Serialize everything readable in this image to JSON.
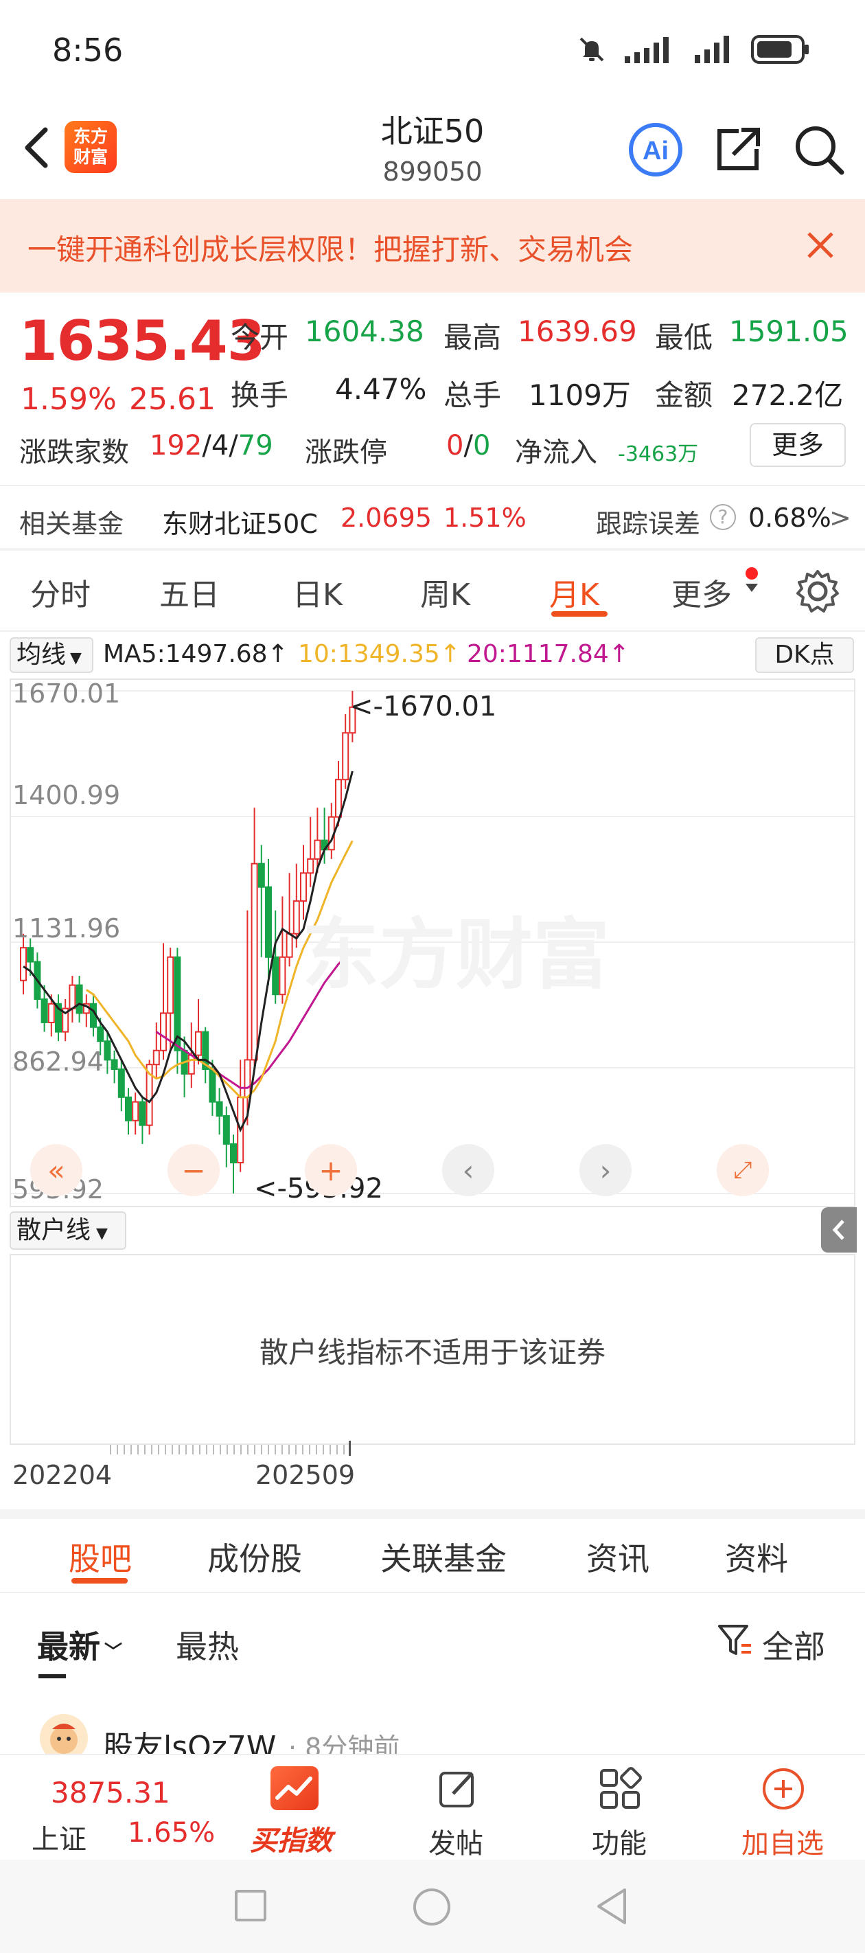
{
  "status": {
    "time": "8:56"
  },
  "header": {
    "title": "北证50",
    "code": "899050",
    "logo_text": "东方财富",
    "ai_label": "Ai"
  },
  "banner": {
    "text": "一键开通科创成长层权限！把握打新、交易机会"
  },
  "quote": {
    "price": "1635.43",
    "change_pct": "1.59%",
    "change_amt": "25.61",
    "open_label": "今开",
    "open": "1604.38",
    "high_label": "最高",
    "high": "1639.69",
    "low_label": "最低",
    "low": "1591.05",
    "turnover_label": "换手",
    "turnover": "4.47%",
    "volume_label": "总手",
    "volume": "1109万",
    "amount_label": "金额",
    "amount": "272.2亿",
    "breadth_label": "涨跌家数",
    "breadth_up": "192",
    "breadth_sep1": "/",
    "breadth_flat": "4",
    "breadth_sep2": "/",
    "breadth_down": "79",
    "limit_label": "涨跌停",
    "limit_up": "0",
    "limit_sep": "/",
    "limit_down": "0",
    "netflow_label": "净流入",
    "netflow": "-3463万",
    "more_label": "更多"
  },
  "fund": {
    "label": "相关基金",
    "name": "东财北证50C",
    "price": "2.0695",
    "change": "1.51%",
    "error_label": "跟踪误差",
    "error": "0.68%",
    "arrow": ">"
  },
  "kline_tabs": [
    "分时",
    "五日",
    "日K",
    "周K",
    "月K",
    "更多"
  ],
  "active_kline_tab": "月K",
  "ma": {
    "selector": "均线",
    "ma5": "MA5:1497.68↑",
    "ma10": "10:1349.35↑",
    "ma20": "20:1117.84↑",
    "dk_label": "DK点",
    "colors": {
      "ma5": "#222222",
      "ma10": "#f0b429",
      "ma20": "#c2188f"
    }
  },
  "chart_data": {
    "type": "candlestick",
    "ylim": [
      593.92,
      1670.01
    ],
    "y_ticks": [
      "1670.01",
      "1400.99",
      "1131.96",
      "862.94",
      "593.92"
    ],
    "max_label": "<-1670.01",
    "min_label": "<-593.92",
    "x_labels": [
      "202204",
      "202509"
    ],
    "watermark": "东方财富",
    "candles": [
      [
        1050,
        1120,
        1020,
        1150
      ],
      [
        1120,
        1090,
        1060,
        1140
      ],
      [
        1090,
        1010,
        990,
        1110
      ],
      [
        1010,
        960,
        940,
        1040
      ],
      [
        960,
        1000,
        930,
        1020
      ],
      [
        1000,
        940,
        920,
        1020
      ],
      [
        940,
        990,
        920,
        1010
      ],
      [
        990,
        1040,
        960,
        1060
      ],
      [
        1040,
        980,
        960,
        1060
      ],
      [
        980,
        1000,
        950,
        1020
      ],
      [
        1000,
        950,
        930,
        1020
      ],
      [
        950,
        920,
        890,
        970
      ],
      [
        920,
        880,
        850,
        940
      ],
      [
        880,
        860,
        830,
        900
      ],
      [
        860,
        800,
        770,
        880
      ],
      [
        800,
        750,
        720,
        820
      ],
      [
        750,
        790,
        720,
        810
      ],
      [
        790,
        740,
        700,
        800
      ],
      [
        740,
        870,
        720,
        880
      ],
      [
        870,
        900,
        840,
        960
      ],
      [
        900,
        980,
        880,
        1130
      ],
      [
        980,
        1100,
        900,
        1120
      ],
      [
        1100,
        900,
        850,
        1120
      ],
      [
        900,
        850,
        800,
        930
      ],
      [
        850,
        890,
        820,
        960
      ],
      [
        890,
        940,
        870,
        1010
      ],
      [
        940,
        860,
        830,
        950
      ],
      [
        860,
        790,
        760,
        880
      ],
      [
        790,
        760,
        720,
        820
      ],
      [
        760,
        700,
        650,
        780
      ],
      [
        700,
        660,
        594,
        720
      ],
      [
        660,
        800,
        640,
        880
      ],
      [
        800,
        880,
        740,
        1200
      ],
      [
        880,
        1300,
        860,
        1420
      ],
      [
        1300,
        1250,
        1100,
        1340
      ],
      [
        1250,
        1100,
        1040,
        1310
      ],
      [
        1100,
        1020,
        1000,
        1200
      ],
      [
        1020,
        1100,
        1000,
        1230
      ],
      [
        1100,
        1150,
        1080,
        1280
      ],
      [
        1150,
        1220,
        1120,
        1300
      ],
      [
        1220,
        1280,
        1180,
        1340
      ],
      [
        1280,
        1310,
        1250,
        1400
      ],
      [
        1310,
        1350,
        1280,
        1420
      ],
      [
        1350,
        1330,
        1300,
        1420
      ],
      [
        1330,
        1400,
        1310,
        1430
      ],
      [
        1400,
        1480,
        1380,
        1520
      ],
      [
        1480,
        1580,
        1460,
        1620
      ],
      [
        1580,
        1635,
        1560,
        1670
      ]
    ],
    "ma5": [
      1080,
      1070,
      1050,
      1030,
      1010,
      990,
      980,
      990,
      1000,
      995,
      985,
      960,
      940,
      910,
      880,
      850,
      820,
      800,
      790,
      810,
      850,
      900,
      930,
      920,
      900,
      880,
      880,
      870,
      850,
      810,
      770,
      730,
      760,
      860,
      960,
      1050,
      1130,
      1160,
      1150,
      1140,
      1160,
      1220,
      1290,
      1330,
      1350,
      1390,
      1440,
      1498
    ],
    "ma10": [
      null,
      null,
      null,
      null,
      null,
      null,
      null,
      null,
      null,
      1030,
      1020,
      1000,
      980,
      960,
      940,
      920,
      890,
      870,
      850,
      840,
      845,
      860,
      870,
      875,
      880,
      880,
      870,
      860,
      845,
      830,
      815,
      800,
      800,
      815,
      840,
      880,
      920,
      980,
      1030,
      1080,
      1120,
      1150,
      1180,
      1220,
      1260,
      1290,
      1320,
      1349
    ],
    "ma20": [
      null,
      null,
      null,
      null,
      null,
      null,
      null,
      null,
      null,
      null,
      null,
      null,
      null,
      null,
      null,
      null,
      null,
      null,
      null,
      940,
      930,
      920,
      910,
      900,
      890,
      880,
      870,
      860,
      850,
      840,
      830,
      820,
      820,
      830,
      845,
      860,
      880,
      900,
      920,
      945,
      970,
      995,
      1020,
      1045,
      1065,
      1085,
      1100,
      1118
    ]
  },
  "sub_indicator": {
    "selector": "散户线",
    "message": "散户线指标不适用于该证券"
  },
  "section_tabs": [
    "股吧",
    "成份股",
    "关联基金",
    "资讯",
    "资料"
  ],
  "sort_tabs": {
    "latest": "最新",
    "hot": "最热",
    "filter": "全部"
  },
  "post": {
    "user": "股友lsQz7W",
    "time": "· 8分钟前"
  },
  "bottom_bar": {
    "index_price": "3875.31",
    "index_name": "上证",
    "index_change": "1.65%",
    "buy_index": "买指数",
    "post": "发帖",
    "functions": "功能",
    "add_watch": "加自选"
  }
}
